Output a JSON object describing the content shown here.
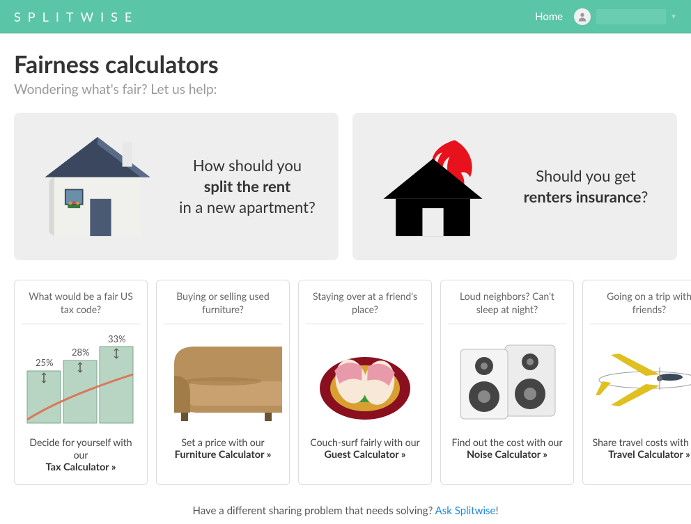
{
  "header": {
    "logo": "SPLITWISE",
    "nav_home": "Home"
  },
  "page": {
    "title": "Fairness calculators",
    "subtitle": "Wondering what's fair? Let us help:"
  },
  "big_cards": {
    "rent": {
      "line1": "How should you",
      "bold": "split the rent",
      "line2": "in a new apartment?"
    },
    "insurance": {
      "line1": "Should you get",
      "bold": "renters insurance",
      "q": "?"
    }
  },
  "small_cards": [
    {
      "title": "What would be a fair US tax code?",
      "tagline": "Decide for yourself with our",
      "cta": "Tax Calculator »",
      "icon": "tax",
      "chart_labels": [
        "25%",
        "28%",
        "33%"
      ]
    },
    {
      "title": "Buying or selling used furniture?",
      "tagline": "Set a price with our",
      "cta": "Furniture Calculator »",
      "icon": "sofa"
    },
    {
      "title": "Staying over at a friend's place?",
      "tagline": "Couch-surf fairly with our",
      "cta": "Guest Calculator »",
      "icon": "slippers"
    },
    {
      "title": "Loud neighbors? Can't sleep at night?",
      "tagline": "Find out the cost with our",
      "cta": "Noise Calculator »",
      "icon": "speakers"
    },
    {
      "title": "Going on a trip with friends?",
      "tagline": "Share travel costs with our",
      "cta": "Travel Calculator »",
      "icon": "plane"
    }
  ],
  "footer": {
    "text": "Have a different sharing problem that needs solving? ",
    "link": "Ask Splitwise",
    "tail": "!"
  }
}
